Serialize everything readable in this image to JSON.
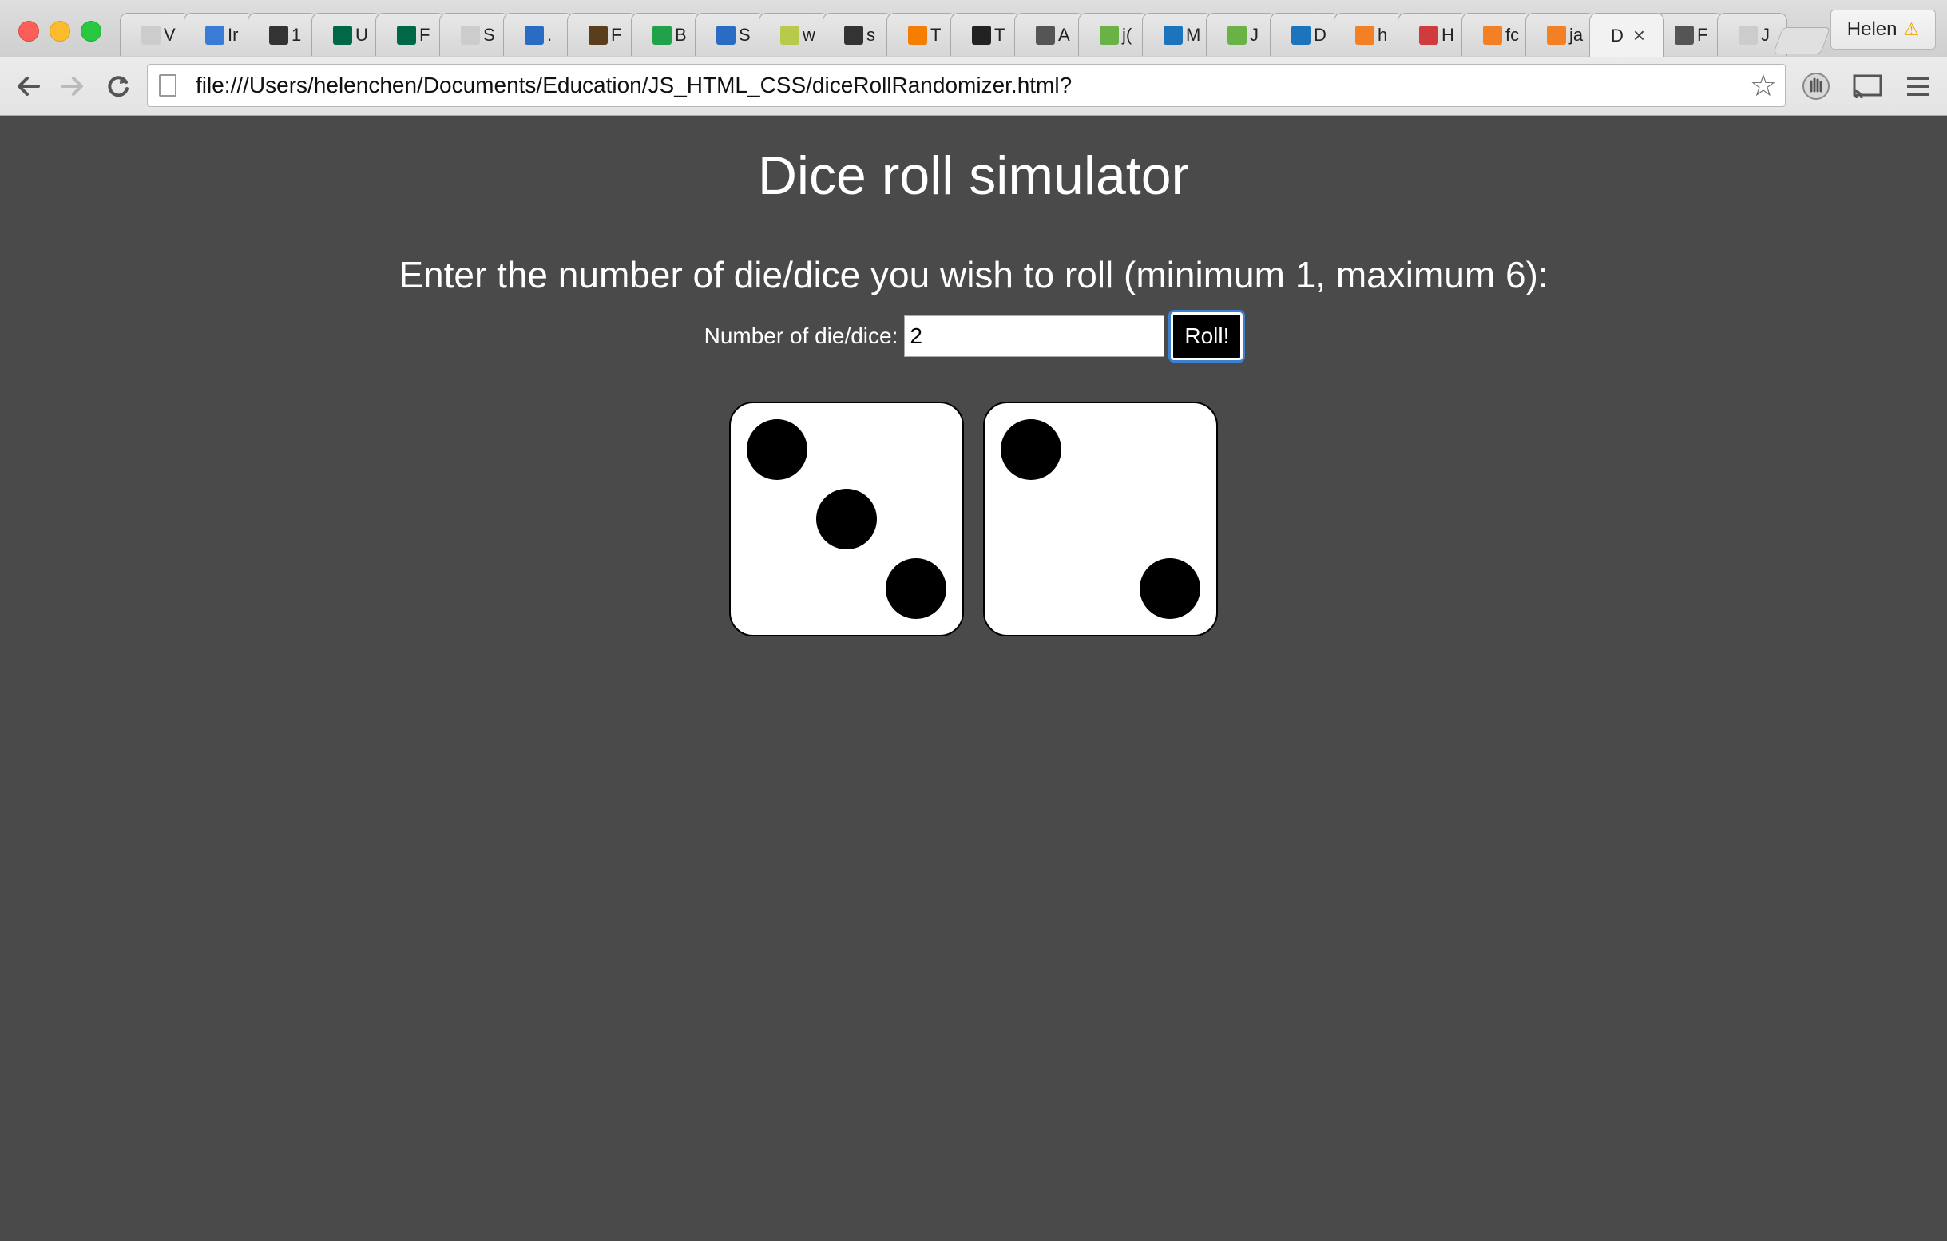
{
  "browser": {
    "tabs": [
      {
        "label": "V",
        "icon": "page-icon",
        "color": "#cccccc"
      },
      {
        "label": "Ir",
        "icon": "mail-icon",
        "color": "#3a7bd5"
      },
      {
        "label": "1",
        "icon": "music-icon",
        "color": "#333333"
      },
      {
        "label": "U",
        "icon": "usf-icon",
        "color": "#006747"
      },
      {
        "label": "F",
        "icon": "usf-icon",
        "color": "#006747"
      },
      {
        "label": "S",
        "icon": "page-icon",
        "color": "#cccccc"
      },
      {
        "label": ".",
        "icon": "swirl-icon",
        "color": "#2a6cc4"
      },
      {
        "label": "F",
        "icon": "rm-icon",
        "color": "#5a3e1b"
      },
      {
        "label": "B",
        "icon": "circle-icon",
        "color": "#1fa24a"
      },
      {
        "label": "S",
        "icon": "swirl-icon",
        "color": "#2a6cc4"
      },
      {
        "label": "w",
        "icon": "l-icon",
        "color": "#b9c94a"
      },
      {
        "label": "s",
        "icon": "spark-icon",
        "color": "#333333"
      },
      {
        "label": "T",
        "icon": "blogger-icon",
        "color": "#f57d00"
      },
      {
        "label": "T",
        "icon": "amazon-icon",
        "color": "#222222"
      },
      {
        "label": "A",
        "icon": "globe-icon",
        "color": "#555555"
      },
      {
        "label": "j(",
        "icon": "w3-icon",
        "color": "#6ab245"
      },
      {
        "label": "M",
        "icon": "chat-icon",
        "color": "#1c75bc"
      },
      {
        "label": "J",
        "icon": "w3-icon",
        "color": "#6ab245"
      },
      {
        "label": "D",
        "icon": "chat-icon",
        "color": "#1c75bc"
      },
      {
        "label": "h",
        "icon": "stack-icon",
        "color": "#f48024"
      },
      {
        "label": "H",
        "icon": "grid-icon",
        "color": "#d03c3c"
      },
      {
        "label": "fc",
        "icon": "stack-icon",
        "color": "#f48024"
      },
      {
        "label": "ja",
        "icon": "stack-icon",
        "color": "#f48024"
      },
      {
        "label": "D",
        "icon": "",
        "color": "",
        "active": true
      },
      {
        "label": "F",
        "icon": "speaker-icon",
        "color": "#555555"
      },
      {
        "label": "J",
        "icon": "page-icon",
        "color": "#cccccc"
      }
    ],
    "profile_name": "Helen",
    "url": "file:///Users/helenchen/Documents/Education/JS_HTML_CSS/diceRollRandomizer.html?"
  },
  "page": {
    "title": "Dice roll simulator",
    "instructions": "Enter the number of die/dice you wish to roll (minimum 1, maximum 6):",
    "input_label": "Number of die/dice:",
    "input_value": "2",
    "roll_button_label": "Roll!"
  },
  "dice": [
    {
      "value": 3
    },
    {
      "value": 2
    }
  ]
}
